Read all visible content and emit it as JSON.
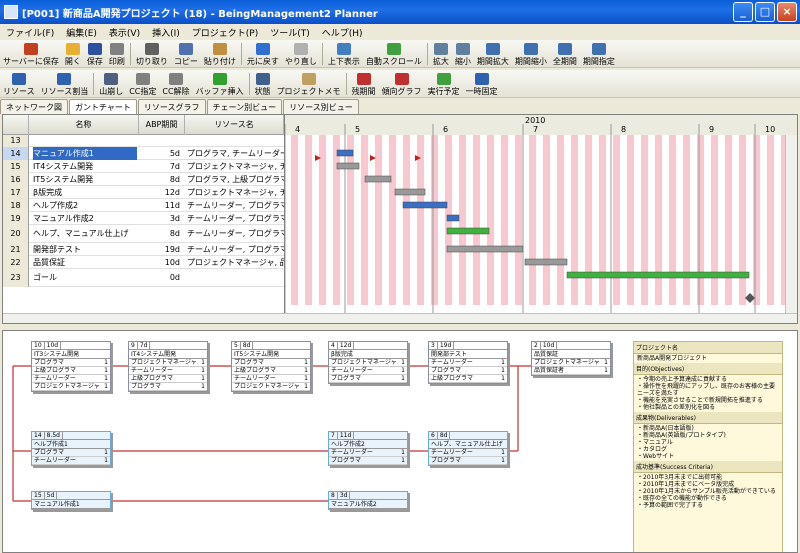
{
  "window": {
    "title": "[P001] 新商品A開発プロジェクト (18) - BeingManagement2 Planner"
  },
  "menu": [
    "ファイル(F)",
    "編集(E)",
    "表示(V)",
    "挿入(I)",
    "プロジェクト(P)",
    "ツール(T)",
    "ヘルプ(H)"
  ],
  "toolbar1": [
    {
      "label": "サーバーに保存",
      "icon": "save-server-icon",
      "color": "#c04020"
    },
    {
      "label": "開く",
      "icon": "open-folder-icon",
      "color": "#e8b030"
    },
    {
      "label": "保存",
      "icon": "save-icon",
      "color": "#3050a0"
    },
    {
      "label": "印刷",
      "icon": "print-icon",
      "color": "#808080"
    },
    {
      "label": "切り取り",
      "icon": "cut-icon",
      "color": "#606060"
    },
    {
      "label": "コピー",
      "icon": "copy-icon",
      "color": "#5070b0"
    },
    {
      "label": "貼り付け",
      "icon": "paste-icon",
      "color": "#c09040"
    },
    {
      "label": "元に戻す",
      "icon": "undo-icon",
      "color": "#3070d0"
    },
    {
      "label": "やり直し",
      "icon": "redo-icon",
      "color": "#b0b0b0"
    },
    {
      "label": "上下表示",
      "icon": "split-view-icon",
      "color": "#4080c0"
    },
    {
      "label": "自動スクロール",
      "icon": "auto-scroll-icon",
      "color": "#40a040"
    },
    {
      "label": "拡大",
      "icon": "zoom-in-icon",
      "color": "#6080a0"
    },
    {
      "label": "縮小",
      "icon": "zoom-out-icon",
      "color": "#6080a0"
    },
    {
      "label": "期間拡大",
      "icon": "period-expand-icon",
      "color": "#4070b0"
    },
    {
      "label": "期間縮小",
      "icon": "period-shrink-icon",
      "color": "#4070b0"
    },
    {
      "label": "全期間",
      "icon": "full-period-icon",
      "color": "#4070b0"
    },
    {
      "label": "期間指定",
      "icon": "period-set-icon",
      "color": "#4070b0"
    }
  ],
  "toolbar2": [
    {
      "label": "リソース",
      "icon": "resource-icon",
      "color": "#3060b0"
    },
    {
      "label": "リソース割当",
      "icon": "resource-assign-icon",
      "color": "#3060b0"
    },
    {
      "label": "山崩し",
      "icon": "leveling-icon",
      "color": "#506080"
    },
    {
      "label": "CC指定",
      "icon": "cc-set-icon",
      "color": "#808080"
    },
    {
      "label": "CC解除",
      "icon": "cc-clear-icon",
      "color": "#808080"
    },
    {
      "label": "バッファ挿入",
      "icon": "buffer-insert-icon",
      "color": "#30a030"
    },
    {
      "label": "状態",
      "icon": "status-icon",
      "color": "#406090"
    },
    {
      "label": "プロジェクトメモ",
      "icon": "project-memo-icon",
      "color": "#c0a060"
    },
    {
      "label": "残期間",
      "icon": "remaining-icon",
      "color": "#c03030"
    },
    {
      "label": "傾向グラフ",
      "icon": "trend-graph-icon",
      "color": "#c03030"
    },
    {
      "label": "実行予定",
      "icon": "plan-icon",
      "color": "#40a040"
    },
    {
      "label": "一時固定",
      "icon": "pin-icon",
      "color": "#3060b0"
    }
  ],
  "tabs": [
    "ネットワーク図",
    "ガントチャート",
    "リソースグラフ",
    "チェーン別ビュー",
    "リソース別ビュー"
  ],
  "grid": {
    "headers": {
      "name": "名称",
      "abp": "ABP期間",
      "resource": "リソース名"
    },
    "rows": [
      {
        "no": "13",
        "name": "",
        "dur": "",
        "res": ""
      },
      {
        "no": "14",
        "name": "マニュアル作成1",
        "dur": "5d",
        "res": "プログラマ, チームリーダー"
      },
      {
        "no": "15",
        "name": "IT4システム開発",
        "dur": "7d",
        "res": "プロジェクトマネージャ, チー"
      },
      {
        "no": "16",
        "name": "IT5システム開発",
        "dur": "8d",
        "res": "プログラマ, 上級プログラマ,"
      },
      {
        "no": "17",
        "name": "β版完成",
        "dur": "12d",
        "res": "プロジェクトマネージャ, チー"
      },
      {
        "no": "18",
        "name": "ヘルプ作成2",
        "dur": "11d",
        "res": "チームリーダー, プログラマ"
      },
      {
        "no": "19",
        "name": "マニュアル作成2",
        "dur": "3d",
        "res": "チームリーダー, プログラマ"
      },
      {
        "no": "20",
        "name": "ヘルプ、マニュアル仕上げ",
        "dur": "8d",
        "res": "チームリーダー, プログラマ"
      },
      {
        "no": "21",
        "name": "開発部テスト",
        "dur": "19d",
        "res": "チームリーダー, プログラマ, ..."
      },
      {
        "no": "22",
        "name": "品質保証",
        "dur": "10d",
        "res": "プロジェクトマネージャ, 品質"
      },
      {
        "no": "23",
        "name": "ゴール",
        "dur": "0d",
        "res": ""
      }
    ]
  },
  "timeline": {
    "year": "2010",
    "months": [
      "4",
      "5",
      "6",
      "7",
      "8",
      "9",
      "10"
    ]
  },
  "network": {
    "nodes": [
      {
        "id": "10",
        "dur": "10d",
        "title": "IT3システム開発",
        "res": [
          "プログラマ",
          "上級プログラマ",
          "チームリーダー",
          "プロジェクトマネージャ"
        ],
        "blue": false
      },
      {
        "id": "9",
        "dur": "7d",
        "title": "IT4システム開発",
        "res": [
          "プロジェクトマネージャ",
          "チームリーダー",
          "上級プログラマ",
          "プログラマ"
        ],
        "blue": false
      },
      {
        "id": "5",
        "dur": "8d",
        "title": "IT5システム開発",
        "res": [
          "プログラマ",
          "上級プログラマ",
          "チームリーダー",
          "プロジェクトマネージャ"
        ],
        "blue": false
      },
      {
        "id": "4",
        "dur": "12d",
        "title": "β版完成",
        "res": [
          "プロジェクトマネージャ",
          "チームリーダー",
          "プログラマ"
        ],
        "blue": false
      },
      {
        "id": "3",
        "dur": "19d",
        "title": "開発部テスト",
        "res": [
          "チームリーダー",
          "プログラマ",
          "上級プログラマ"
        ],
        "blue": false
      },
      {
        "id": "2",
        "dur": "10d",
        "title": "品質保証",
        "res": [
          "プロジェクトマネージャ",
          "品質保証者"
        ],
        "blue": false
      },
      {
        "id": "14",
        "dur": "8.5d",
        "title": "ヘルプ作成1",
        "res": [
          "プログラマ",
          "チームリーダー"
        ],
        "blue": true
      },
      {
        "id": "7",
        "dur": "11d",
        "title": "ヘルプ作成2",
        "res": [
          "チームリーダー",
          "プログラマ"
        ],
        "blue": true
      },
      {
        "id": "6",
        "dur": "8d",
        "title": "ヘルプ、マニュアル仕上げ",
        "res": [
          "チームリーダー",
          "プログラマ"
        ],
        "blue": true
      },
      {
        "id": "15",
        "dur": "5d",
        "title": "マニュアル作成1",
        "res": [],
        "blue": true
      },
      {
        "id": "8",
        "dur": "3d",
        "title": "マニュアル作成2",
        "res": [],
        "blue": true
      }
    ]
  },
  "info": {
    "project_label": "プロジェクト名",
    "project_name": "新商品A開発プロジェクト",
    "objectives_label": "目的(Objectives)",
    "objectives": [
      "・今期の売上予算達成に貢献する",
      "・操作性を飛躍的にアップし、既存のお客様の主要ニーズを満たす",
      "・機能を充実させることで新規開拓を推進する",
      "・他社製品との差別化を図る"
    ],
    "deliverables_label": "成果物(Deliverables)",
    "deliverables": [
      "・新商品A(日本語版)",
      "・新商品A(英語版/プロトタイプ)",
      "・マニュアル",
      "・カタログ",
      "・Webサイト"
    ],
    "success_label": "成功基準(Success Criteria)",
    "success": [
      "・2010年3月末までに出荷可能",
      "・2010年1月末までにベータ版完成",
      "・2010年1月末からサンプル販売活動ができている",
      "・既存の全ての機能が動作できる",
      "・予算の範囲で完了する"
    ]
  }
}
